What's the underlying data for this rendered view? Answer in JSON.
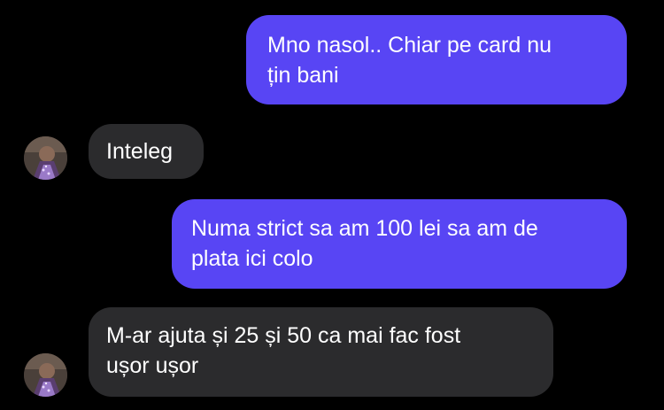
{
  "conversation": {
    "messages": [
      {
        "from": "me",
        "text": "Mno nasol.. Chiar pe card nu\nțin bani"
      },
      {
        "from": "contact",
        "text": "Inteleg"
      },
      {
        "from": "me",
        "text": "Numa strict sa am 100 lei sa am de\nplata ici colo"
      },
      {
        "from": "contact",
        "text": "M-ar ajuta și 25 și 50 ca mai fac fost\nușor ușor"
      }
    ]
  },
  "colors": {
    "background": "#000000",
    "outgoing_bubble": "#5845f4",
    "incoming_bubble": "#2b2b2d",
    "text": "#ffffff"
  },
  "icons": {
    "contact_avatar": "contact-avatar-icon"
  }
}
